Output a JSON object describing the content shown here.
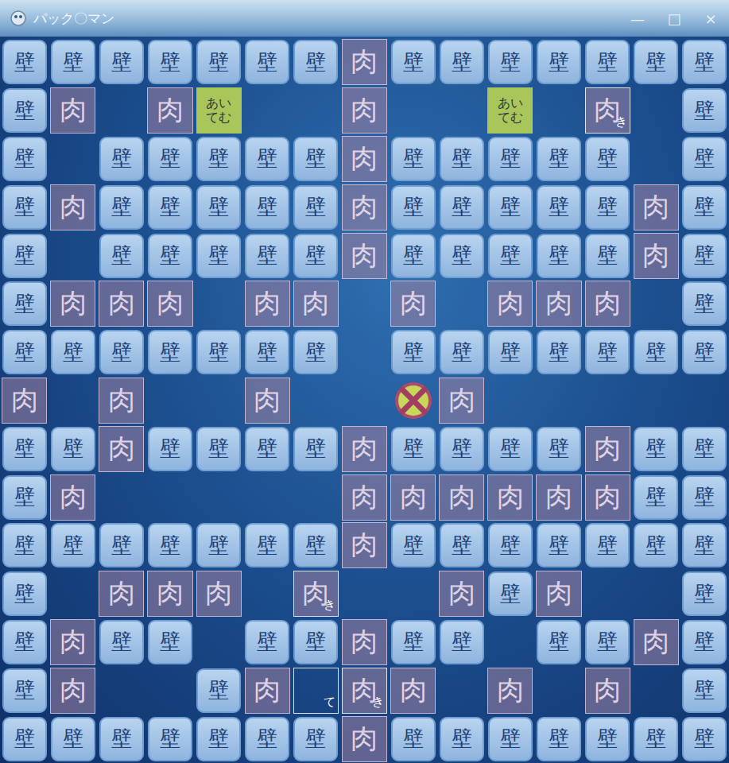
{
  "window": {
    "title": "パック〇マン",
    "controls": [
      "—",
      "□",
      "×"
    ]
  },
  "board": {
    "rows": [
      [
        {
          "kind": "wall",
          "text": "壁"
        },
        {
          "kind": "wall",
          "text": "壁"
        },
        {
          "kind": "wall",
          "text": "壁"
        },
        {
          "kind": "wall",
          "text": "壁"
        },
        {
          "kind": "wall",
          "text": "壁"
        },
        {
          "kind": "wall",
          "text": "壁"
        },
        {
          "kind": "wall",
          "text": "壁"
        },
        {
          "kind": "meat",
          "text": "肉"
        },
        {
          "kind": "wall",
          "text": "壁"
        },
        {
          "kind": "wall",
          "text": "壁"
        },
        {
          "kind": "wall",
          "text": "壁"
        },
        {
          "kind": "wall",
          "text": "壁"
        },
        {
          "kind": "wall",
          "text": "壁"
        },
        {
          "kind": "wall",
          "text": "壁"
        },
        {
          "kind": "wall",
          "text": "壁"
        }
      ],
      [
        {
          "kind": "wall",
          "text": "壁"
        },
        {
          "kind": "meat",
          "text": "肉"
        },
        {
          "kind": "empty",
          "text": ""
        },
        {
          "kind": "meat",
          "text": "肉"
        },
        {
          "kind": "item",
          "text": "あいてむ"
        },
        {
          "kind": "empty",
          "text": ""
        },
        {
          "kind": "empty",
          "text": ""
        },
        {
          "kind": "meat",
          "text": "肉"
        },
        {
          "kind": "empty",
          "text": ""
        },
        {
          "kind": "empty",
          "text": ""
        },
        {
          "kind": "item",
          "text": "あいてむ"
        },
        {
          "kind": "empty",
          "text": ""
        },
        {
          "kind": "enemy",
          "text": "肉",
          "label": "き"
        },
        {
          "kind": "empty",
          "text": ""
        },
        {
          "kind": "wall",
          "text": "壁"
        }
      ],
      [
        {
          "kind": "wall",
          "text": "壁"
        },
        {
          "kind": "empty",
          "text": ""
        },
        {
          "kind": "wall",
          "text": "壁"
        },
        {
          "kind": "wall",
          "text": "壁"
        },
        {
          "kind": "wall",
          "text": "壁"
        },
        {
          "kind": "wall",
          "text": "壁"
        },
        {
          "kind": "wall",
          "text": "壁"
        },
        {
          "kind": "meat",
          "text": "肉"
        },
        {
          "kind": "wall",
          "text": "壁"
        },
        {
          "kind": "wall",
          "text": "壁"
        },
        {
          "kind": "wall",
          "text": "壁"
        },
        {
          "kind": "wall",
          "text": "壁"
        },
        {
          "kind": "wall",
          "text": "壁"
        },
        {
          "kind": "empty",
          "text": ""
        },
        {
          "kind": "wall",
          "text": "壁"
        }
      ],
      [
        {
          "kind": "wall",
          "text": "壁"
        },
        {
          "kind": "meat",
          "text": "肉"
        },
        {
          "kind": "wall",
          "text": "壁"
        },
        {
          "kind": "wall",
          "text": "壁"
        },
        {
          "kind": "wall",
          "text": "壁"
        },
        {
          "kind": "wall",
          "text": "壁"
        },
        {
          "kind": "wall",
          "text": "壁"
        },
        {
          "kind": "meat",
          "text": "肉"
        },
        {
          "kind": "wall",
          "text": "壁"
        },
        {
          "kind": "wall",
          "text": "壁"
        },
        {
          "kind": "wall",
          "text": "壁"
        },
        {
          "kind": "wall",
          "text": "壁"
        },
        {
          "kind": "wall",
          "text": "壁"
        },
        {
          "kind": "meat",
          "text": "肉"
        },
        {
          "kind": "wall",
          "text": "壁"
        }
      ],
      [
        {
          "kind": "wall",
          "text": "壁"
        },
        {
          "kind": "empty",
          "text": ""
        },
        {
          "kind": "wall",
          "text": "壁"
        },
        {
          "kind": "wall",
          "text": "壁"
        },
        {
          "kind": "wall",
          "text": "壁"
        },
        {
          "kind": "wall",
          "text": "壁"
        },
        {
          "kind": "wall",
          "text": "壁"
        },
        {
          "kind": "meat",
          "text": "肉"
        },
        {
          "kind": "wall",
          "text": "壁"
        },
        {
          "kind": "wall",
          "text": "壁"
        },
        {
          "kind": "wall",
          "text": "壁"
        },
        {
          "kind": "wall",
          "text": "壁"
        },
        {
          "kind": "wall",
          "text": "壁"
        },
        {
          "kind": "meat",
          "text": "肉"
        },
        {
          "kind": "wall",
          "text": "壁"
        }
      ],
      [
        {
          "kind": "wall",
          "text": "壁"
        },
        {
          "kind": "meat",
          "text": "肉"
        },
        {
          "kind": "meat",
          "text": "肉"
        },
        {
          "kind": "meat",
          "text": "肉"
        },
        {
          "kind": "empty",
          "text": ""
        },
        {
          "kind": "meat",
          "text": "肉"
        },
        {
          "kind": "meat",
          "text": "肉"
        },
        {
          "kind": "empty",
          "text": ""
        },
        {
          "kind": "meat",
          "text": "肉"
        },
        {
          "kind": "empty",
          "text": ""
        },
        {
          "kind": "meat",
          "text": "肉"
        },
        {
          "kind": "meat",
          "text": "肉"
        },
        {
          "kind": "meat",
          "text": "肉"
        },
        {
          "kind": "empty",
          "text": ""
        },
        {
          "kind": "wall",
          "text": "壁"
        }
      ],
      [
        {
          "kind": "wall",
          "text": "壁"
        },
        {
          "kind": "wall",
          "text": "壁"
        },
        {
          "kind": "wall",
          "text": "壁"
        },
        {
          "kind": "wall",
          "text": "壁"
        },
        {
          "kind": "wall",
          "text": "壁"
        },
        {
          "kind": "wall",
          "text": "壁"
        },
        {
          "kind": "wall",
          "text": "壁"
        },
        {
          "kind": "empty",
          "text": ""
        },
        {
          "kind": "wall",
          "text": "壁"
        },
        {
          "kind": "wall",
          "text": "壁"
        },
        {
          "kind": "wall",
          "text": "壁"
        },
        {
          "kind": "wall",
          "text": "壁"
        },
        {
          "kind": "wall",
          "text": "壁"
        },
        {
          "kind": "wall",
          "text": "壁"
        },
        {
          "kind": "wall",
          "text": "壁"
        }
      ],
      [
        {
          "kind": "meat",
          "text": "肉"
        },
        {
          "kind": "empty",
          "text": ""
        },
        {
          "kind": "meat",
          "text": "肉"
        },
        {
          "kind": "empty",
          "text": ""
        },
        {
          "kind": "empty",
          "text": ""
        },
        {
          "kind": "meat",
          "text": "肉"
        },
        {
          "kind": "empty",
          "text": ""
        },
        {
          "kind": "empty",
          "text": ""
        },
        {
          "kind": "player",
          "text": ""
        },
        {
          "kind": "meat",
          "text": "肉"
        },
        {
          "kind": "empty",
          "text": ""
        },
        {
          "kind": "empty",
          "text": ""
        },
        {
          "kind": "empty",
          "text": ""
        },
        {
          "kind": "empty",
          "text": ""
        },
        {
          "kind": "empty",
          "text": ""
        }
      ],
      [
        {
          "kind": "wall",
          "text": "壁"
        },
        {
          "kind": "wall",
          "text": "壁"
        },
        {
          "kind": "meat",
          "text": "肉"
        },
        {
          "kind": "wall",
          "text": "壁"
        },
        {
          "kind": "wall",
          "text": "壁"
        },
        {
          "kind": "wall",
          "text": "壁"
        },
        {
          "kind": "wall",
          "text": "壁"
        },
        {
          "kind": "meat",
          "text": "肉"
        },
        {
          "kind": "wall",
          "text": "壁"
        },
        {
          "kind": "wall",
          "text": "壁"
        },
        {
          "kind": "wall",
          "text": "壁"
        },
        {
          "kind": "wall",
          "text": "壁"
        },
        {
          "kind": "meat",
          "text": "肉"
        },
        {
          "kind": "wall",
          "text": "壁"
        },
        {
          "kind": "wall",
          "text": "壁"
        }
      ],
      [
        {
          "kind": "wall",
          "text": "壁"
        },
        {
          "kind": "meat",
          "text": "肉"
        },
        {
          "kind": "empty",
          "text": ""
        },
        {
          "kind": "empty",
          "text": ""
        },
        {
          "kind": "empty",
          "text": ""
        },
        {
          "kind": "empty",
          "text": ""
        },
        {
          "kind": "empty",
          "text": ""
        },
        {
          "kind": "meat",
          "text": "肉"
        },
        {
          "kind": "meat",
          "text": "肉"
        },
        {
          "kind": "meat",
          "text": "肉"
        },
        {
          "kind": "meat",
          "text": "肉"
        },
        {
          "kind": "meat",
          "text": "肉"
        },
        {
          "kind": "meat",
          "text": "肉"
        },
        {
          "kind": "wall",
          "text": "壁"
        },
        {
          "kind": "wall",
          "text": "壁"
        }
      ],
      [
        {
          "kind": "wall",
          "text": "壁"
        },
        {
          "kind": "wall",
          "text": "壁"
        },
        {
          "kind": "wall",
          "text": "壁"
        },
        {
          "kind": "wall",
          "text": "壁"
        },
        {
          "kind": "wall",
          "text": "壁"
        },
        {
          "kind": "wall",
          "text": "壁"
        },
        {
          "kind": "wall",
          "text": "壁"
        },
        {
          "kind": "meat",
          "text": "肉"
        },
        {
          "kind": "wall",
          "text": "壁"
        },
        {
          "kind": "wall",
          "text": "壁"
        },
        {
          "kind": "wall",
          "text": "壁"
        },
        {
          "kind": "wall",
          "text": "壁"
        },
        {
          "kind": "wall",
          "text": "壁"
        },
        {
          "kind": "wall",
          "text": "壁"
        },
        {
          "kind": "wall",
          "text": "壁"
        }
      ],
      [
        {
          "kind": "wall",
          "text": "壁"
        },
        {
          "kind": "empty",
          "text": ""
        },
        {
          "kind": "meat",
          "text": "肉"
        },
        {
          "kind": "meat",
          "text": "肉"
        },
        {
          "kind": "meat",
          "text": "肉"
        },
        {
          "kind": "empty",
          "text": ""
        },
        {
          "kind": "enemy",
          "text": "肉",
          "label": "き"
        },
        {
          "kind": "empty",
          "text": ""
        },
        {
          "kind": "empty",
          "text": ""
        },
        {
          "kind": "meat",
          "text": "肉"
        },
        {
          "kind": "wall",
          "text": "壁"
        },
        {
          "kind": "meat",
          "text": "肉"
        },
        {
          "kind": "empty",
          "text": ""
        },
        {
          "kind": "empty",
          "text": ""
        },
        {
          "kind": "wall",
          "text": "壁"
        }
      ],
      [
        {
          "kind": "wall",
          "text": "壁"
        },
        {
          "kind": "meat",
          "text": "肉"
        },
        {
          "kind": "wall",
          "text": "壁"
        },
        {
          "kind": "wall",
          "text": "壁"
        },
        {
          "kind": "empty",
          "text": ""
        },
        {
          "kind": "wall",
          "text": "壁"
        },
        {
          "kind": "wall",
          "text": "壁"
        },
        {
          "kind": "meat",
          "text": "肉"
        },
        {
          "kind": "wall",
          "text": "壁"
        },
        {
          "kind": "wall",
          "text": "壁"
        },
        {
          "kind": "empty",
          "text": ""
        },
        {
          "kind": "wall",
          "text": "壁"
        },
        {
          "kind": "wall",
          "text": "壁"
        },
        {
          "kind": "meat",
          "text": "肉"
        },
        {
          "kind": "wall",
          "text": "壁"
        }
      ],
      [
        {
          "kind": "wall",
          "text": "壁"
        },
        {
          "kind": "meat",
          "text": "肉"
        },
        {
          "kind": "empty",
          "text": ""
        },
        {
          "kind": "empty",
          "text": ""
        },
        {
          "kind": "wall",
          "text": "壁"
        },
        {
          "kind": "meat",
          "text": "肉"
        },
        {
          "kind": "enemy",
          "text": "",
          "label": "て"
        },
        {
          "kind": "enemy",
          "text": "肉",
          "label": "き"
        },
        {
          "kind": "meat",
          "text": "肉"
        },
        {
          "kind": "empty",
          "text": ""
        },
        {
          "kind": "meat",
          "text": "肉"
        },
        {
          "kind": "empty",
          "text": ""
        },
        {
          "kind": "meat",
          "text": "肉"
        },
        {
          "kind": "empty",
          "text": ""
        },
        {
          "kind": "wall",
          "text": "壁"
        }
      ],
      [
        {
          "kind": "wall",
          "text": "壁"
        },
        {
          "kind": "wall",
          "text": "壁"
        },
        {
          "kind": "wall",
          "text": "壁"
        },
        {
          "kind": "wall",
          "text": "壁"
        },
        {
          "kind": "wall",
          "text": "壁"
        },
        {
          "kind": "wall",
          "text": "壁"
        },
        {
          "kind": "wall",
          "text": "壁"
        },
        {
          "kind": "meat",
          "text": "肉"
        },
        {
          "kind": "wall",
          "text": "壁"
        },
        {
          "kind": "wall",
          "text": "壁"
        },
        {
          "kind": "wall",
          "text": "壁"
        },
        {
          "kind": "wall",
          "text": "壁"
        },
        {
          "kind": "wall",
          "text": "壁"
        },
        {
          "kind": "wall",
          "text": "壁"
        },
        {
          "kind": "wall",
          "text": "壁"
        }
      ]
    ]
  }
}
